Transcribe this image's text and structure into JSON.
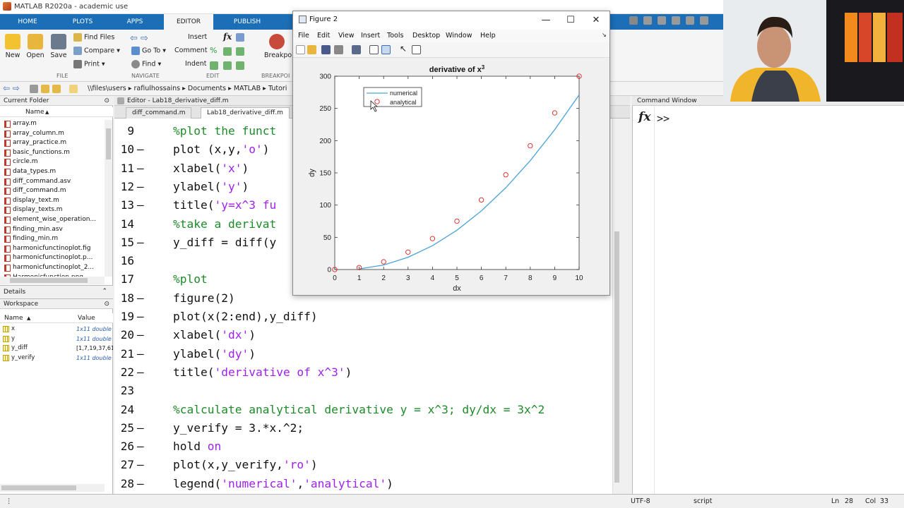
{
  "window": {
    "title": "MATLAB R2020a - academic use"
  },
  "tabs": [
    {
      "label": "HOME"
    },
    {
      "label": "PLOTS"
    },
    {
      "label": "APPS"
    },
    {
      "label": "EDITOR"
    },
    {
      "label": "PUBLISH"
    }
  ],
  "ribbon": {
    "file": {
      "new": "New",
      "open": "Open",
      "save": "Save",
      "find_files": "Find Files",
      "compare": "Compare",
      "print": "Print",
      "section": "FILE"
    },
    "navigate": {
      "go_to": "Go To",
      "find": "Find",
      "section": "NAVIGATE"
    },
    "edit": {
      "insert": "Insert",
      "comment": "Comment",
      "indent": "Indent",
      "fx": "fx",
      "section": "EDIT"
    },
    "breakpoints": {
      "label": "Breakpoi",
      "section": "BREAKPOI"
    }
  },
  "address": {
    "segments": [
      "\\\\files\\users",
      "rafiulhossains",
      "Documents",
      "MATLAB",
      "Tutori"
    ]
  },
  "current_folder": {
    "title": "Current Folder",
    "column": "Name",
    "files": [
      "array.m",
      "array_column.m",
      "array_practice.m",
      "basic_functions.m",
      "circle.m",
      "data_types.m",
      "diff_command.asv",
      "diff_command.m",
      "display_text.m",
      "display_texts.m",
      "element_wise_operation...",
      "finding_min.asv",
      "finding_min.m",
      "harmonicfunctinoplot.fig",
      "harmonicfunctinoplot.p...",
      "harmonicfunctinoplot_2...",
      "Harmonicfunction.png"
    ]
  },
  "details": {
    "title": "Details"
  },
  "workspace": {
    "title": "Workspace",
    "columns": {
      "name": "Name",
      "value": "Value"
    },
    "vars": [
      {
        "name": "x",
        "value": "1x11 double"
      },
      {
        "name": "y",
        "value": "1x11 double"
      },
      {
        "name": "y_diff",
        "value": "[1,7,19,37,61"
      },
      {
        "name": "y_verify",
        "value": "1x11 double"
      }
    ]
  },
  "editor": {
    "header": "Editor - Lab18_derivative_diff.m",
    "tabs": [
      {
        "label": "diff_command.m"
      },
      {
        "label": "Lab18_derivative_diff.m"
      }
    ],
    "lines": [
      {
        "num": "9",
        "dash": "",
        "parts": [
          {
            "t": "%plot the funct",
            "c": "cmt"
          }
        ]
      },
      {
        "num": "10",
        "dash": "—",
        "parts": [
          {
            "t": "plot (x,y,",
            "c": ""
          },
          {
            "t": "'o'",
            "c": "str"
          },
          {
            "t": ")",
            "c": ""
          }
        ]
      },
      {
        "num": "11",
        "dash": "—",
        "parts": [
          {
            "t": "xlabel(",
            "c": ""
          },
          {
            "t": "'x'",
            "c": "str"
          },
          {
            "t": ")",
            "c": ""
          }
        ]
      },
      {
        "num": "12",
        "dash": "—",
        "parts": [
          {
            "t": "ylabel(",
            "c": ""
          },
          {
            "t": "'y'",
            "c": "str"
          },
          {
            "t": ")",
            "c": ""
          }
        ]
      },
      {
        "num": "13",
        "dash": "—",
        "parts": [
          {
            "t": "title(",
            "c": ""
          },
          {
            "t": "'y=x^3 fu",
            "c": "str"
          }
        ]
      },
      {
        "num": "14",
        "dash": "",
        "parts": [
          {
            "t": "%take a derivat",
            "c": "cmt"
          }
        ]
      },
      {
        "num": "15",
        "dash": "—",
        "parts": [
          {
            "t": "y_diff = diff(y",
            "c": ""
          }
        ]
      },
      {
        "num": "16",
        "dash": "",
        "parts": []
      },
      {
        "num": "17",
        "dash": "",
        "parts": [
          {
            "t": "%plot",
            "c": "cmt"
          }
        ]
      },
      {
        "num": "18",
        "dash": "—",
        "parts": [
          {
            "t": "figure(2)",
            "c": ""
          }
        ]
      },
      {
        "num": "19",
        "dash": "—",
        "parts": [
          {
            "t": "plot(x(2:end),y_diff)",
            "c": ""
          }
        ]
      },
      {
        "num": "20",
        "dash": "—",
        "parts": [
          {
            "t": "xlabel(",
            "c": ""
          },
          {
            "t": "'dx'",
            "c": "str"
          },
          {
            "t": ")",
            "c": ""
          }
        ]
      },
      {
        "num": "21",
        "dash": "—",
        "parts": [
          {
            "t": "ylabel(",
            "c": ""
          },
          {
            "t": "'dy'",
            "c": "str"
          },
          {
            "t": ")",
            "c": ""
          }
        ]
      },
      {
        "num": "22",
        "dash": "—",
        "parts": [
          {
            "t": "title(",
            "c": ""
          },
          {
            "t": "'derivative of x^3'",
            "c": "str"
          },
          {
            "t": ")",
            "c": ""
          }
        ]
      },
      {
        "num": "23",
        "dash": "",
        "parts": []
      },
      {
        "num": "24",
        "dash": "",
        "parts": [
          {
            "t": "%calculate analytical derivative y = x^3; dy/dx = 3x^2",
            "c": "cmt"
          }
        ]
      },
      {
        "num": "25",
        "dash": "—",
        "parts": [
          {
            "t": "y_verify = 3.*x.^2;",
            "c": ""
          }
        ]
      },
      {
        "num": "26",
        "dash": "—",
        "parts": [
          {
            "t": "hold ",
            "c": ""
          },
          {
            "t": "on",
            "c": "str"
          }
        ]
      },
      {
        "num": "27",
        "dash": "—",
        "parts": [
          {
            "t": "plot(x,y_verify,",
            "c": ""
          },
          {
            "t": "'ro'",
            "c": "str"
          },
          {
            "t": ")",
            "c": ""
          }
        ]
      },
      {
        "num": "28",
        "dash": "—",
        "parts": [
          {
            "t": "legend(",
            "c": ""
          },
          {
            "t": "'numerical'",
            "c": "str"
          },
          {
            "t": ",",
            "c": ""
          },
          {
            "t": "'analytical'",
            "c": "str"
          },
          {
            "t": ")",
            "c": ""
          }
        ]
      }
    ]
  },
  "command_window": {
    "title": "Command Window",
    "fx": "fx",
    "prompt": ">>"
  },
  "status": {
    "encoding": "UTF-8",
    "mode": "script",
    "ln_label": "Ln",
    "ln": "28",
    "col_label": "Col",
    "col": "33"
  },
  "figure": {
    "title": "Figure 2",
    "menu": [
      "File",
      "Edit",
      "View",
      "Insert",
      "Tools",
      "Desktop",
      "Window",
      "Help"
    ]
  },
  "colors": {
    "ribbon_blue": "#1c6fb7",
    "comment": "#1c8b28",
    "string": "#a020f0",
    "line_series": "#4aa3d8",
    "marker_series": "#e02020"
  },
  "chart_data": {
    "type": "line",
    "title": "derivative of x",
    "title_sup": "3",
    "xlabel": "dx",
    "ylabel": "dy",
    "xlim": [
      0,
      10
    ],
    "ylim": [
      0,
      300
    ],
    "xticks": [
      0,
      1,
      2,
      3,
      4,
      5,
      6,
      7,
      8,
      9,
      10
    ],
    "yticks": [
      0,
      50,
      100,
      150,
      200,
      250,
      300
    ],
    "legend": {
      "position": "top-left",
      "entries": [
        "numerical",
        "analytical"
      ]
    },
    "series": [
      {
        "name": "numerical",
        "style": "line",
        "x": [
          1,
          2,
          3,
          4,
          5,
          6,
          7,
          8,
          9,
          10
        ],
        "y": [
          1,
          7,
          19,
          37,
          61,
          91,
          127,
          169,
          217,
          271
        ]
      },
      {
        "name": "analytical",
        "style": "markers",
        "x": [
          0,
          1,
          2,
          3,
          4,
          5,
          6,
          7,
          8,
          9,
          10
        ],
        "y": [
          0,
          3,
          12,
          27,
          48,
          75,
          108,
          147,
          192,
          243,
          300
        ]
      }
    ]
  }
}
